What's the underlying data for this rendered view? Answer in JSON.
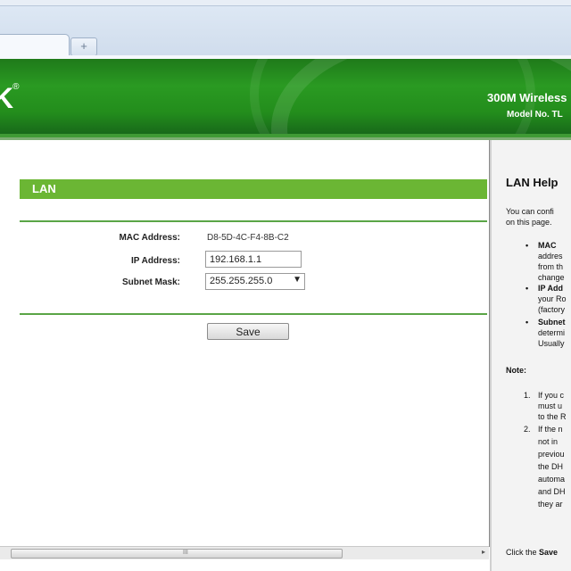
{
  "browser": {
    "new_tab_symbol": "+"
  },
  "banner": {
    "logo_text": "K",
    "logo_reg": "®",
    "product_name": "300M Wireless",
    "model_no": "Model No. TL"
  },
  "lan_section": {
    "title": "LAN",
    "mac_label": "MAC Address:",
    "mac_value": "D8-5D-4C-F4-8B-C2",
    "ip_label": "IP Address:",
    "ip_value": "192.168.1.1",
    "mask_label": "Subnet Mask:",
    "mask_value": "255.255.255.0",
    "mask_arrow": "▼",
    "save_label": "Save"
  },
  "scrollbar": {
    "grip": "III",
    "right_arrow": "▸"
  },
  "help": {
    "title": "LAN Help",
    "intro_1": "You can confi",
    "intro_2": "on this page.",
    "b1_bullet": "•",
    "b1_title": "MAC",
    "b1_l1": "addres",
    "b1_l2": "from th",
    "b1_l3": "change",
    "b2_bullet": "•",
    "b2_title": "IP Add",
    "b2_l1": "your Ro",
    "b2_l2": "(factory",
    "b3_bullet": "•",
    "b3_title": "Subnet",
    "b3_l1": "determi",
    "b3_l2": "Usually",
    "note_label": "Note:",
    "n1_num": "1.",
    "n1_l1": "If you c",
    "n1_l2": "must u",
    "n1_l3": "to the R",
    "n2_num": "2.",
    "n2_l1": "If the n",
    "n2_l2": "not in",
    "n2_l3": "previou",
    "n2_l4": "the DH",
    "n2_l5": "automa",
    "n2_l6": "and DH",
    "n2_l7": "they ar",
    "footer_pre": "Click the",
    "footer_bold": "Save"
  }
}
